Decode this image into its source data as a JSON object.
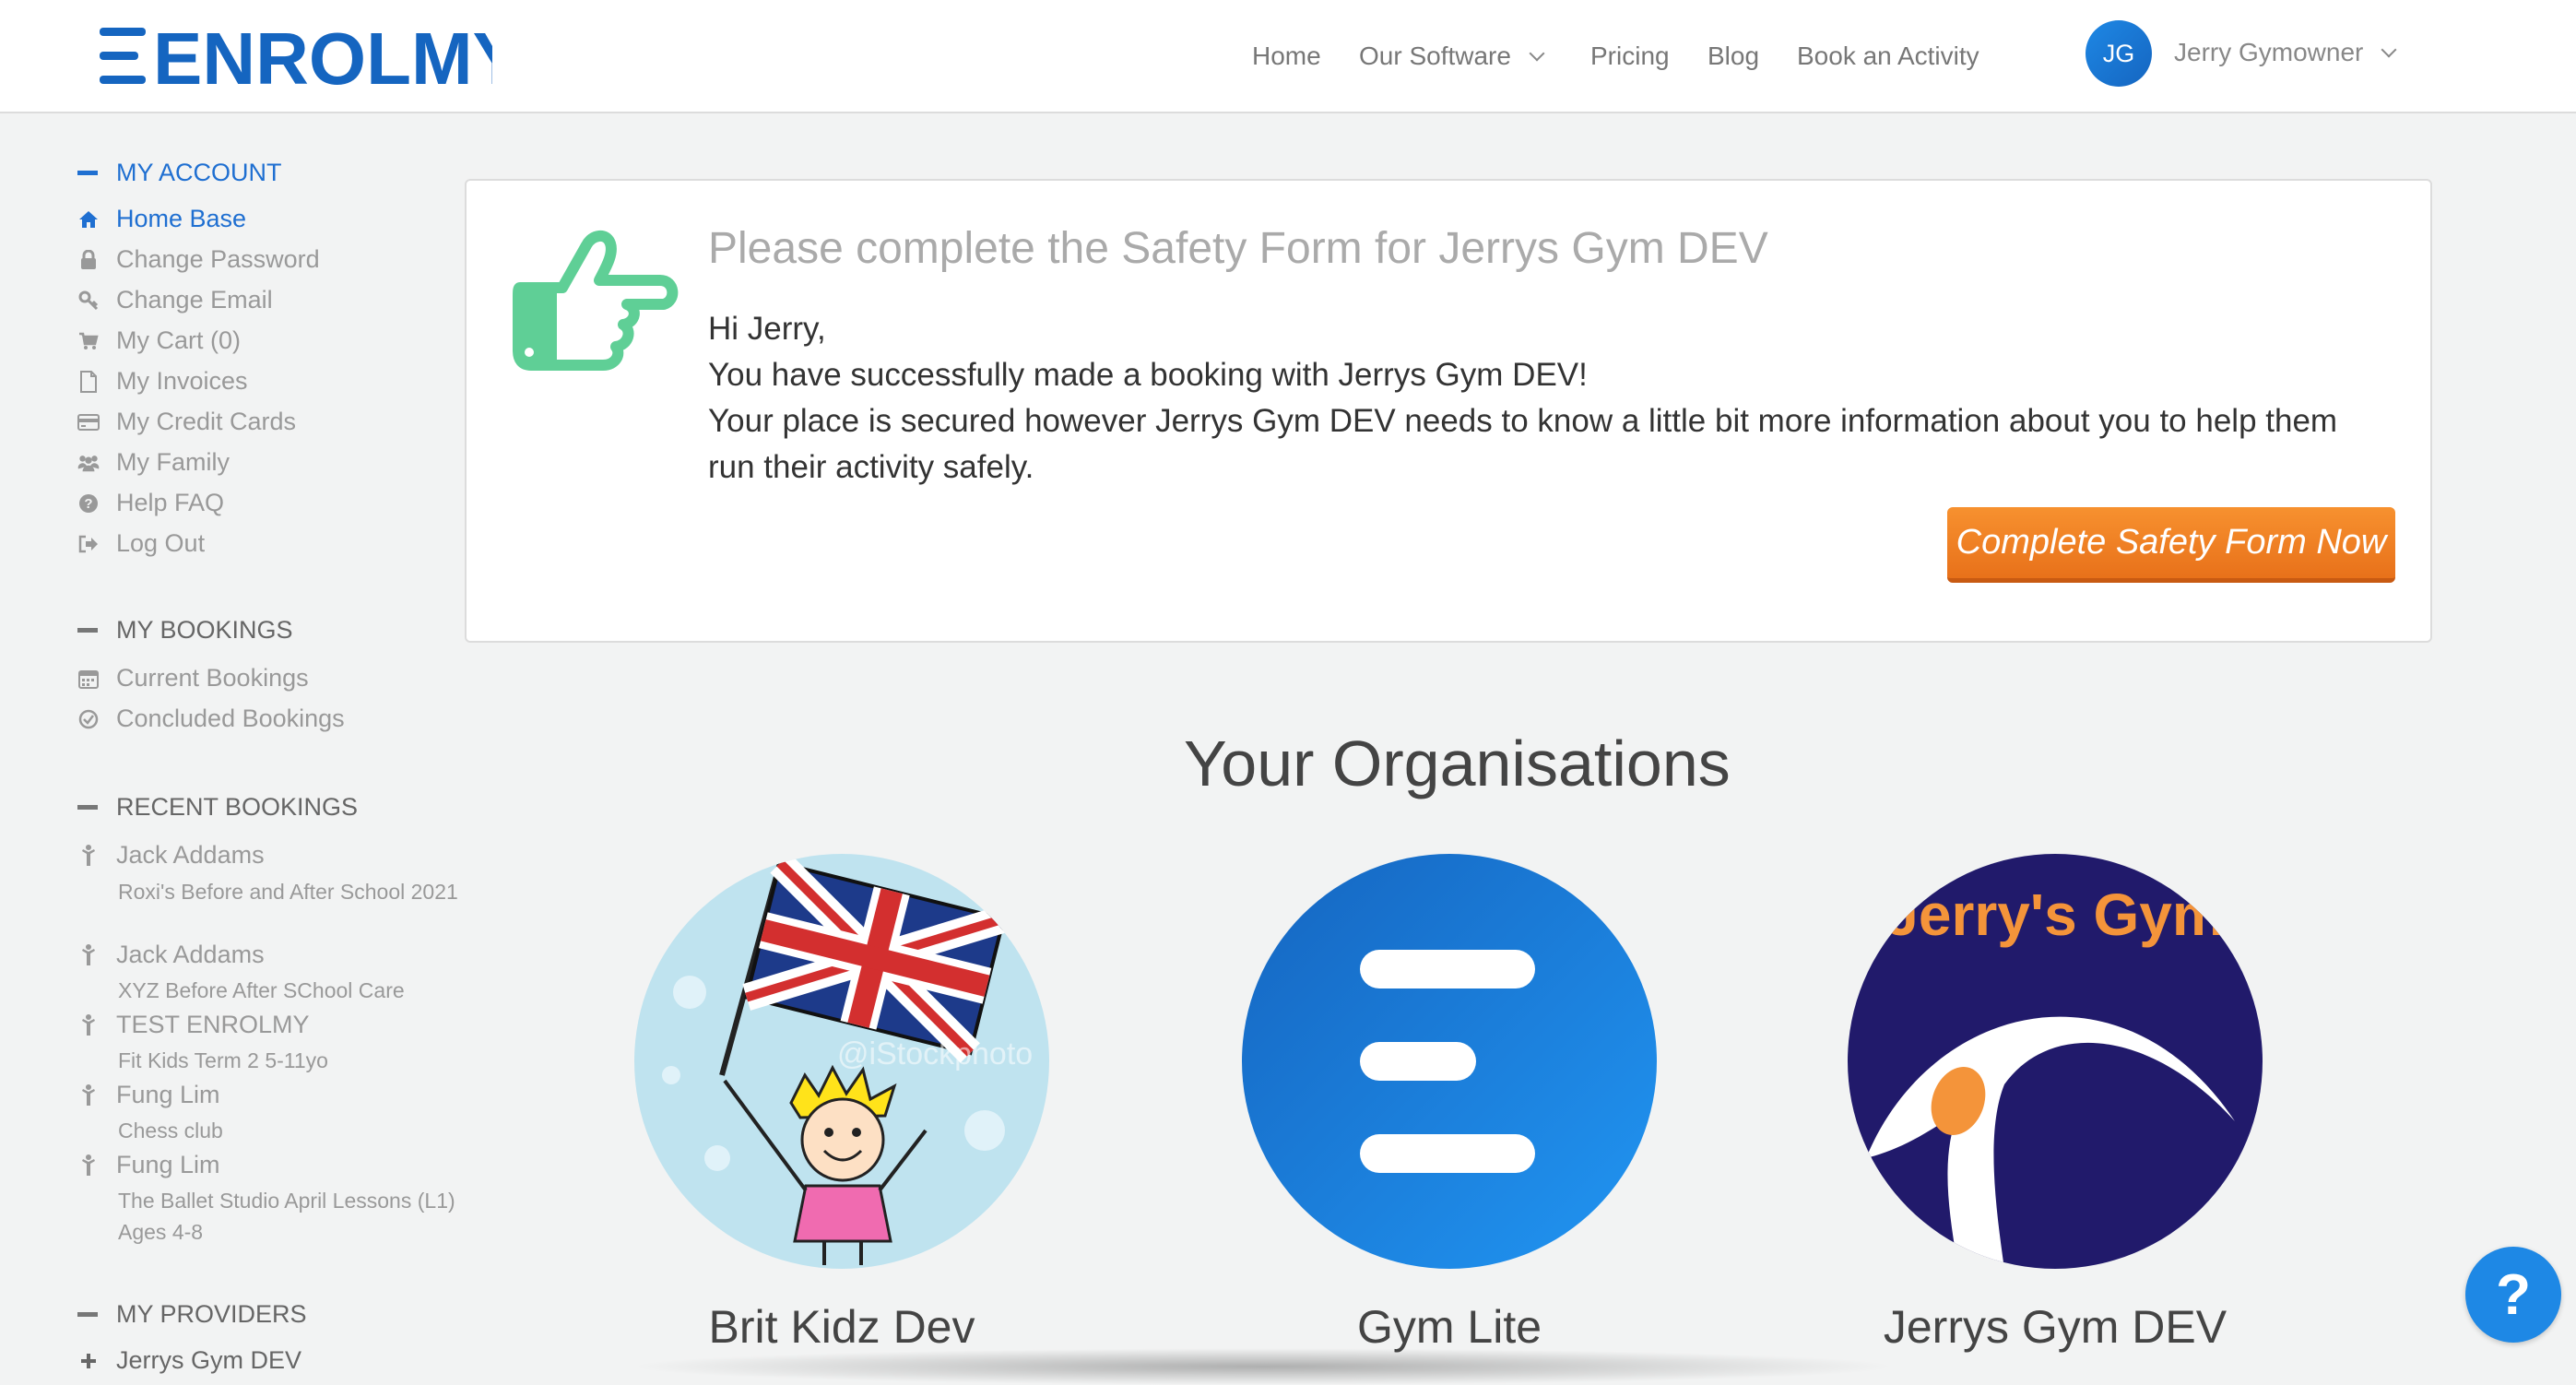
{
  "header": {
    "logo_text": "ENROLMY",
    "nav": [
      {
        "label": "Home"
      },
      {
        "label": "Our Software"
      },
      {
        "label": "Pricing"
      },
      {
        "label": "Blog"
      },
      {
        "label": "Book an Activity"
      }
    ],
    "user_initials": "JG",
    "user_name": "Jerry Gymowner"
  },
  "sidebar": {
    "my_account": {
      "title": "MY ACCOUNT",
      "items": [
        {
          "label": "Home Base",
          "icon": "home-icon"
        },
        {
          "label": "Change Password",
          "icon": "lock-icon"
        },
        {
          "label": "Change Email",
          "icon": "key-icon"
        },
        {
          "label": "My Cart (0)",
          "icon": "cart-icon"
        },
        {
          "label": "My Invoices",
          "icon": "document-icon"
        },
        {
          "label": "My Credit Cards",
          "icon": "credit-card-icon"
        },
        {
          "label": "My Family",
          "icon": "users-icon"
        },
        {
          "label": "Help FAQ",
          "icon": "question-circle-icon"
        },
        {
          "label": "Log Out",
          "icon": "sign-out-icon"
        }
      ]
    },
    "my_bookings": {
      "title": "MY BOOKINGS",
      "items": [
        {
          "label": "Current Bookings",
          "icon": "calendar-icon"
        },
        {
          "label": "Concluded Bookings",
          "icon": "check-circle-icon"
        }
      ]
    },
    "recent_bookings": {
      "title": "RECENT BOOKINGS",
      "items": [
        {
          "name": "Jack Addams",
          "activity": "Roxi's Before and After School 2021"
        },
        {
          "name": "Jack Addams",
          "activity": "XYZ Before After SChool Care"
        },
        {
          "name": "TEST ENROLMY",
          "activity": "Fit Kids Term 2 5-11yo"
        },
        {
          "name": "Fung Lim",
          "activity": "Chess club"
        },
        {
          "name": "Fung Lim",
          "activity": "The Ballet Studio April Lessons (L1) Ages 4-8"
        }
      ]
    },
    "my_providers": {
      "title": "MY PROVIDERS",
      "items": [
        {
          "label": "Jerrys Gym DEV"
        }
      ]
    }
  },
  "safety_card": {
    "title": "Please complete the Safety Form for Jerrys Gym DEV",
    "greeting": "Hi Jerry,",
    "line1": "You have successfully made a booking with Jerrys Gym DEV!",
    "line2": "Your place is secured however Jerrys Gym DEV needs to know a little bit more information about you to help them run their activity safely.",
    "button_label": "Complete Safety Form Now"
  },
  "organisations": {
    "title": "Your Organisations",
    "items": [
      {
        "name": "Brit Kidz Dev",
        "watermark": "@iStockphoto"
      },
      {
        "name": "Gym Lite"
      },
      {
        "name": "Jerrys Gym DEV",
        "logo_text": "Jerry's Gym"
      }
    ]
  },
  "help_button": {
    "label": "?"
  },
  "colors": {
    "accent_blue": "#1f6fd1",
    "cta_orange": "#f08222",
    "thumb_green": "#5fcf96",
    "jerrys_navy": "#211a6b"
  }
}
